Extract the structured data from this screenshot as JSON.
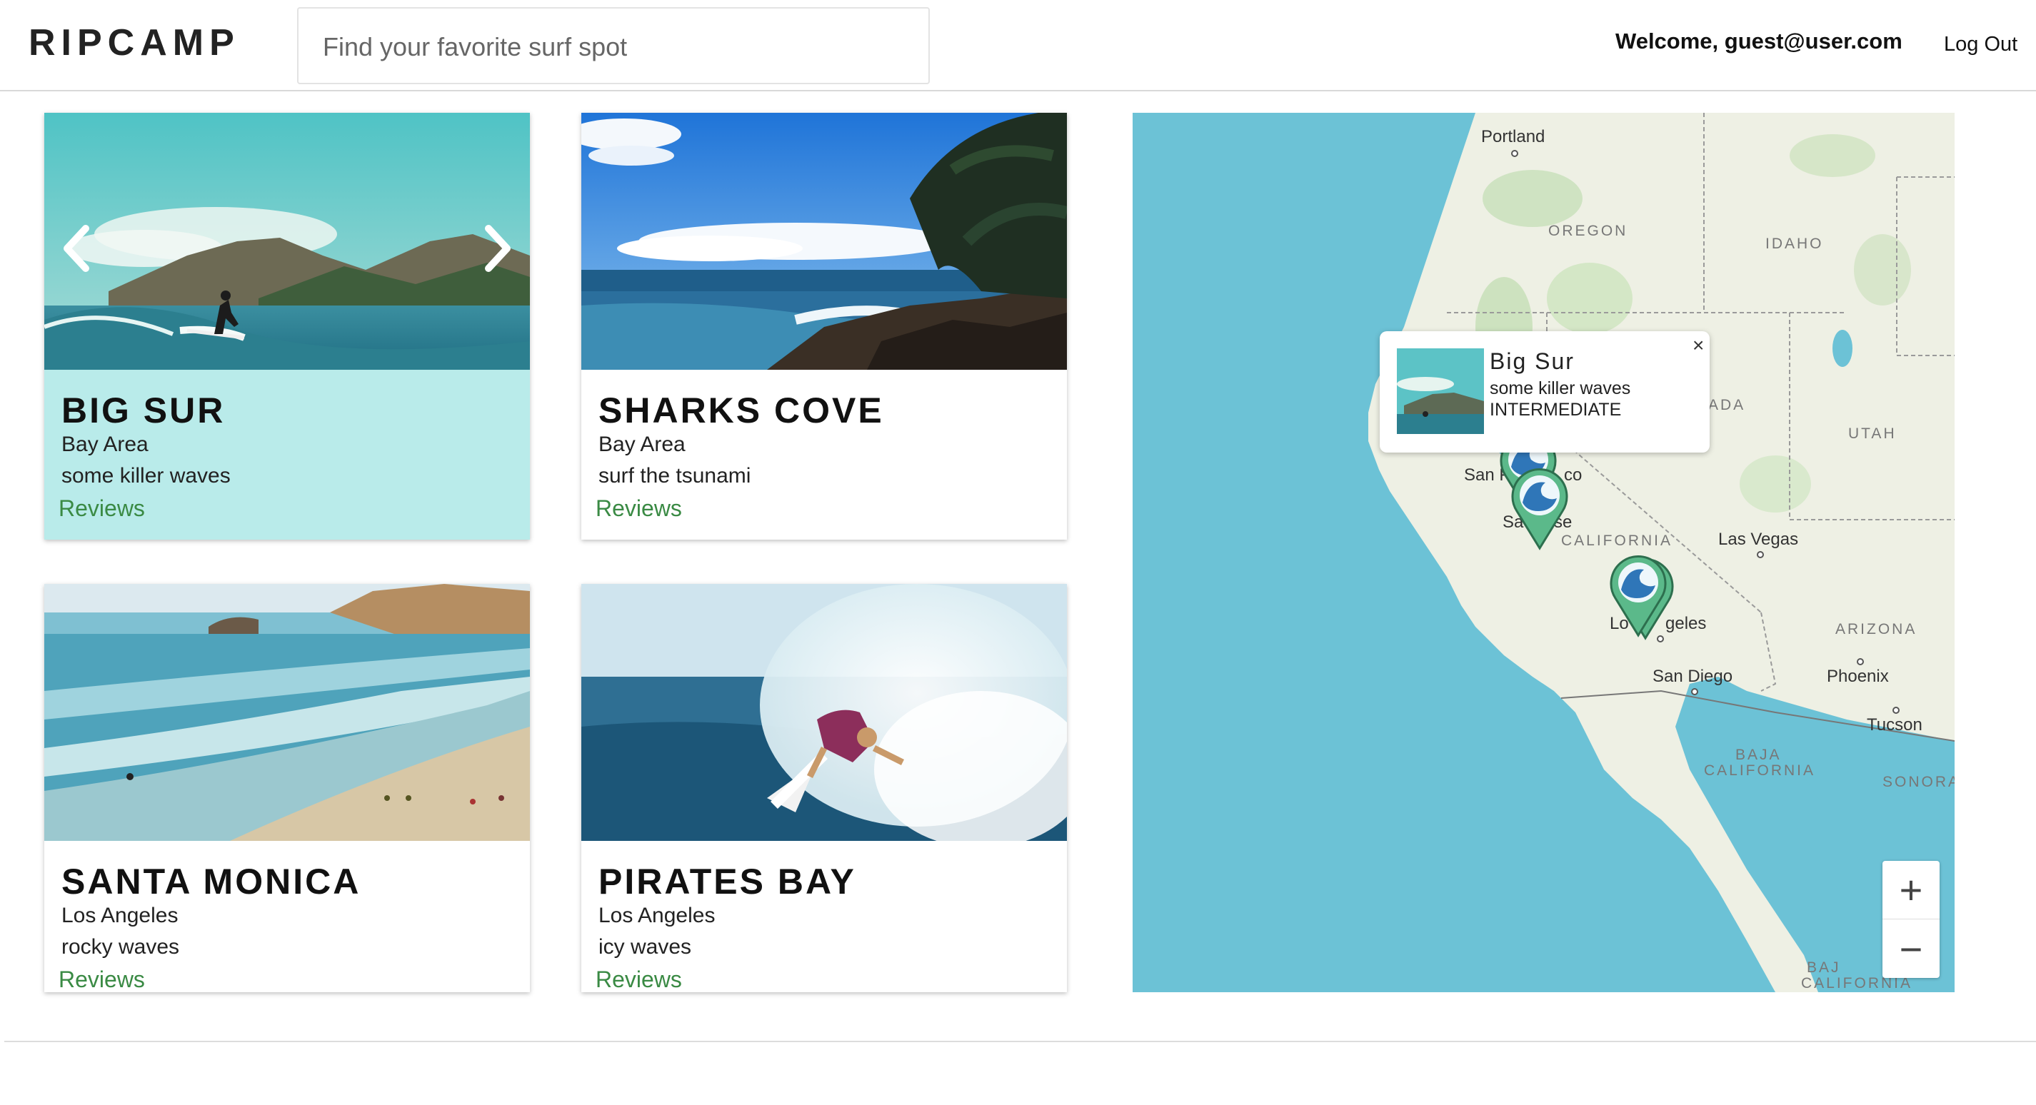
{
  "header": {
    "logo": "RIPCAMP",
    "search_placeholder": "Find your favorite surf spot",
    "welcome": "Welcome, guest@user.com",
    "logout": "Log Out"
  },
  "cards": [
    {
      "title": "BIG SUR",
      "location": "Bay Area",
      "description": "some killer waves",
      "reviews": "Reviews"
    },
    {
      "title": "SHARKS COVE",
      "location": "Bay Area",
      "description": "surf the tsunami",
      "reviews": "Reviews"
    },
    {
      "title": "SANTA MONICA",
      "location": "Los Angeles",
      "description": "rocky waves",
      "reviews": "Reviews"
    },
    {
      "title": "PIRATES BAY",
      "location": "Los Angeles",
      "description": "icy waves",
      "reviews": "Reviews"
    }
  ],
  "map": {
    "cities": [
      "Portland",
      "San Francisco",
      "San Jose",
      "Las Vegas",
      "Los Angeles",
      "San Diego",
      "Phoenix",
      "Tucson"
    ],
    "city_labels": {
      "portland": "Portland",
      "sf": "San F",
      "sf2": "co",
      "sj": "Sa",
      "sj2": "se",
      "vegas": "Las Vegas",
      "la": "Lo",
      "la2": "geles",
      "sd": "San Diego",
      "phoenix": "Phoenix",
      "tucson": "Tucson"
    },
    "regions": {
      "oregon": "OREGON",
      "idaho": "IDAHO",
      "nevada": "ADA",
      "utah": "UTAH",
      "california": "CALIFORNIA",
      "arizona": "ARIZONA",
      "baja1": "BAJA",
      "baja2": "CALIFORNIA",
      "sonora": "SONORA",
      "bajasur1": "BAJ",
      "bajasur2": "CALIFORNIA SUR"
    },
    "popup": {
      "title": "Big Sur",
      "description": "some killer waves",
      "level": "INTERMEDIATE",
      "close": "×"
    },
    "zoom_in": "+",
    "zoom_out": "−"
  },
  "colors": {
    "active_card": "#b9ebea",
    "reviews_link": "#3a8a44",
    "ocean": "#6cc2d6",
    "land": "#eef0e4",
    "marker": "#5bb98a"
  }
}
